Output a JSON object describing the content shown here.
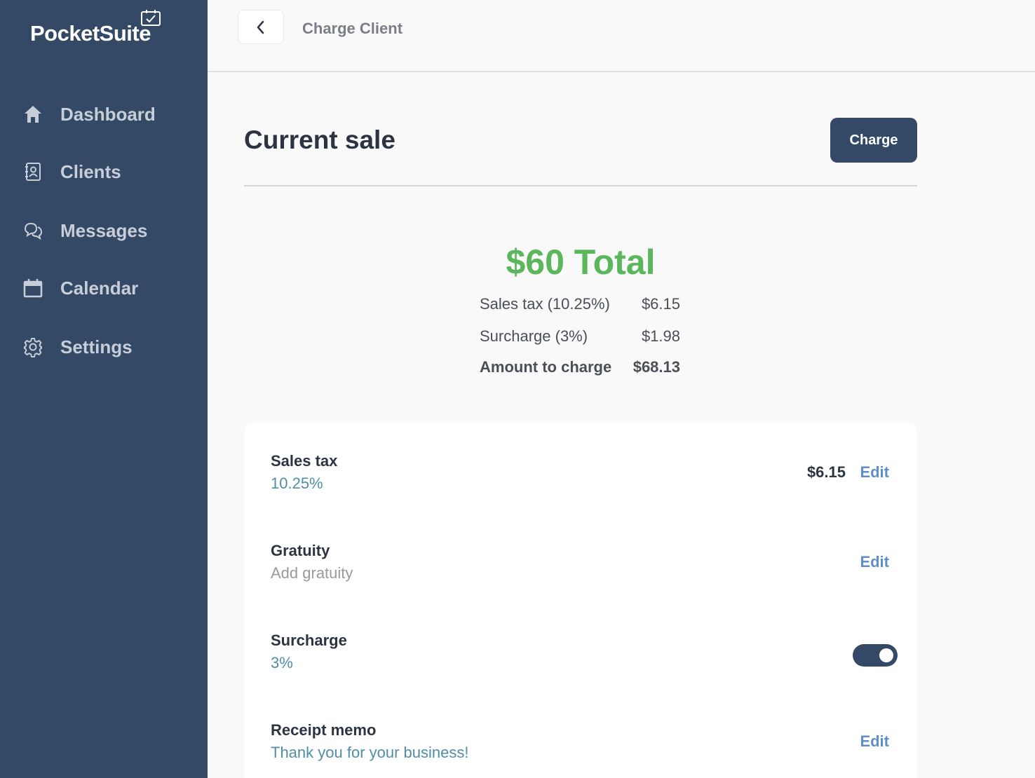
{
  "app": {
    "logo": "PocketSuite"
  },
  "sidebar": {
    "items": [
      {
        "label": "Dashboard",
        "icon": "home-icon"
      },
      {
        "label": "Clients",
        "icon": "contact-book-icon"
      },
      {
        "label": "Messages",
        "icon": "chat-bubbles-icon"
      },
      {
        "label": "Calendar",
        "icon": "calendar-icon"
      },
      {
        "label": "Settings",
        "icon": "gear-icon"
      }
    ]
  },
  "header": {
    "title": "Charge Client",
    "back_icon": "chevron-left-icon"
  },
  "main": {
    "title": "Current sale",
    "charge_label": "Charge",
    "total": "$60 Total",
    "summary": [
      {
        "label": "Sales tax (10.25%)",
        "value": "$6.15"
      },
      {
        "label": "Surcharge (3%)",
        "value": "$1.98"
      },
      {
        "label": "Amount to charge",
        "value": "$68.13"
      }
    ],
    "rows": {
      "sales_tax": {
        "title": "Sales tax",
        "sub": "10.25%",
        "amount": "$6.15",
        "edit": "Edit"
      },
      "gratuity": {
        "title": "Gratuity",
        "sub": "Add gratuity",
        "edit": "Edit"
      },
      "surcharge": {
        "title": "Surcharge",
        "sub": "3%",
        "enabled": true
      },
      "memo": {
        "title": "Receipt memo",
        "sub": "Thank you for your business!",
        "edit": "Edit"
      }
    }
  },
  "colors": {
    "sidebar": "#344966",
    "total_green": "#5cb65c",
    "link_blue": "#5e8ec7",
    "teal_text": "#4f8fa6"
  }
}
